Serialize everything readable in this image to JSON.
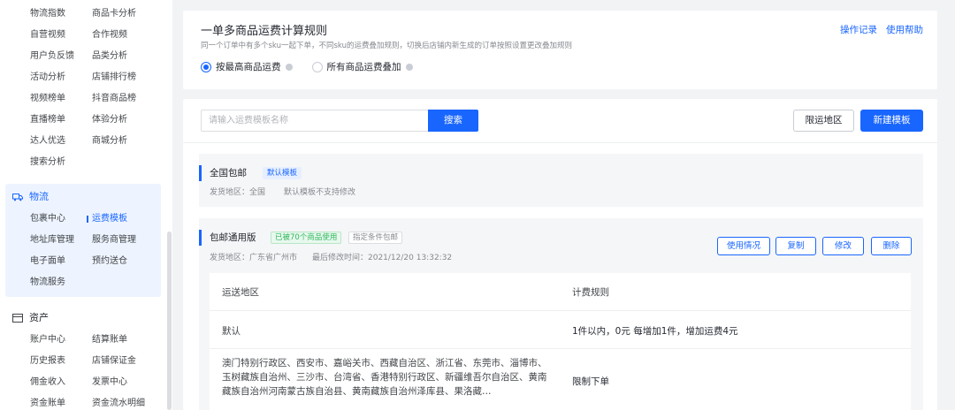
{
  "sidebar": {
    "analytics_items": [
      "物流指数",
      "商品卡分析",
      "自营视频",
      "合作视频",
      "用户负反馈",
      "品类分析",
      "活动分析",
      "店铺排行榜",
      "视频榜单",
      "抖音商品榜",
      "直播榜单",
      "体验分析",
      "达人优选",
      "商城分析",
      "搜索分析"
    ],
    "logistics": {
      "title": "物流",
      "items": [
        "包裹中心",
        "运费模板",
        "地址库管理",
        "服务商管理",
        "电子面单",
        "预约送仓",
        "物流服务"
      ],
      "active": "运费模板"
    },
    "assets": {
      "title": "资产",
      "items": [
        "账户中心",
        "结算账单",
        "历史报表",
        "店铺保证金",
        "佣金收入",
        "发票中心",
        "资金账单",
        "资金流水明细"
      ]
    }
  },
  "rule_panel": {
    "title": "一单多商品运费计算规则",
    "description": "同一个订单中有多个sku一起下单，不同sku的运费叠加规则，切换后店铺内新生成的订单按照设置更改叠加规则",
    "options": [
      {
        "label": "按最高商品运费",
        "selected": true
      },
      {
        "label": "所有商品运费叠加",
        "selected": false
      }
    ],
    "links": [
      "操作记录",
      "使用帮助"
    ]
  },
  "toolbar": {
    "search_placeholder": "请输入运费模板名称",
    "search_label": "搜索",
    "restricted_label": "限运地区",
    "new_label": "新建模板"
  },
  "templates": [
    {
      "name": "全国包邮",
      "tags": [
        "默认模板"
      ],
      "ship_from": "发货地区：全国",
      "note": "默认模板不支持修改"
    },
    {
      "name": "包邮通用版",
      "tags": [
        "已被70个商品使用",
        "指定条件包邮"
      ],
      "ship_from": "发货地区：广东省广州市",
      "modified": "最后修改时间：2021/12/20 13:32:32",
      "actions": [
        "使用情况",
        "复制",
        "修改",
        "删除"
      ],
      "table": {
        "headers": [
          "运送地区",
          "计费规则"
        ],
        "rows": [
          {
            "region": "默认",
            "rule": "1件以内，0元    每增加1件，增加运费4元"
          },
          {
            "region": "澳门特别行政区、西安市、嘉峪关市、西藏自治区、浙江省、东莞市、淄博市、玉树藏族自治州、三沙市、台湾省、香港特别行政区、新疆维吾尔自治区、黄南藏族自治州河南蒙古族自治县、黄南藏族自治州泽库县、果洛藏…",
            "rule": "限制下单"
          }
        ]
      }
    }
  ]
}
